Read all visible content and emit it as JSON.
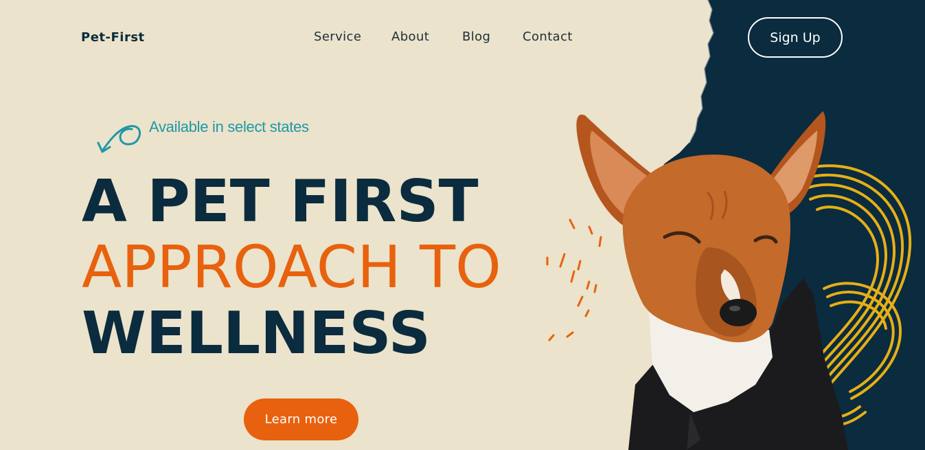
{
  "brand": {
    "name": "Pet-First"
  },
  "nav": {
    "items": [
      {
        "label": "Service"
      },
      {
        "label": "About"
      },
      {
        "label": "Blog"
      },
      {
        "label": "Contact"
      }
    ],
    "signup_label": "Sign Up"
  },
  "hero": {
    "tagline": "Available in select states",
    "headline": {
      "line1": "A PET FIRST",
      "line2": "APPROACH TO",
      "line3": "WELLNESS"
    },
    "cta_label": "Learn more"
  },
  "colors": {
    "background": "#ebe3cb",
    "navy": "#0b2b3e",
    "orange": "#e8610e",
    "teal": "#1f97a7",
    "yellow": "#f2b714"
  },
  "icons": {
    "tagline_arrow": "curly-arrow-icon"
  }
}
